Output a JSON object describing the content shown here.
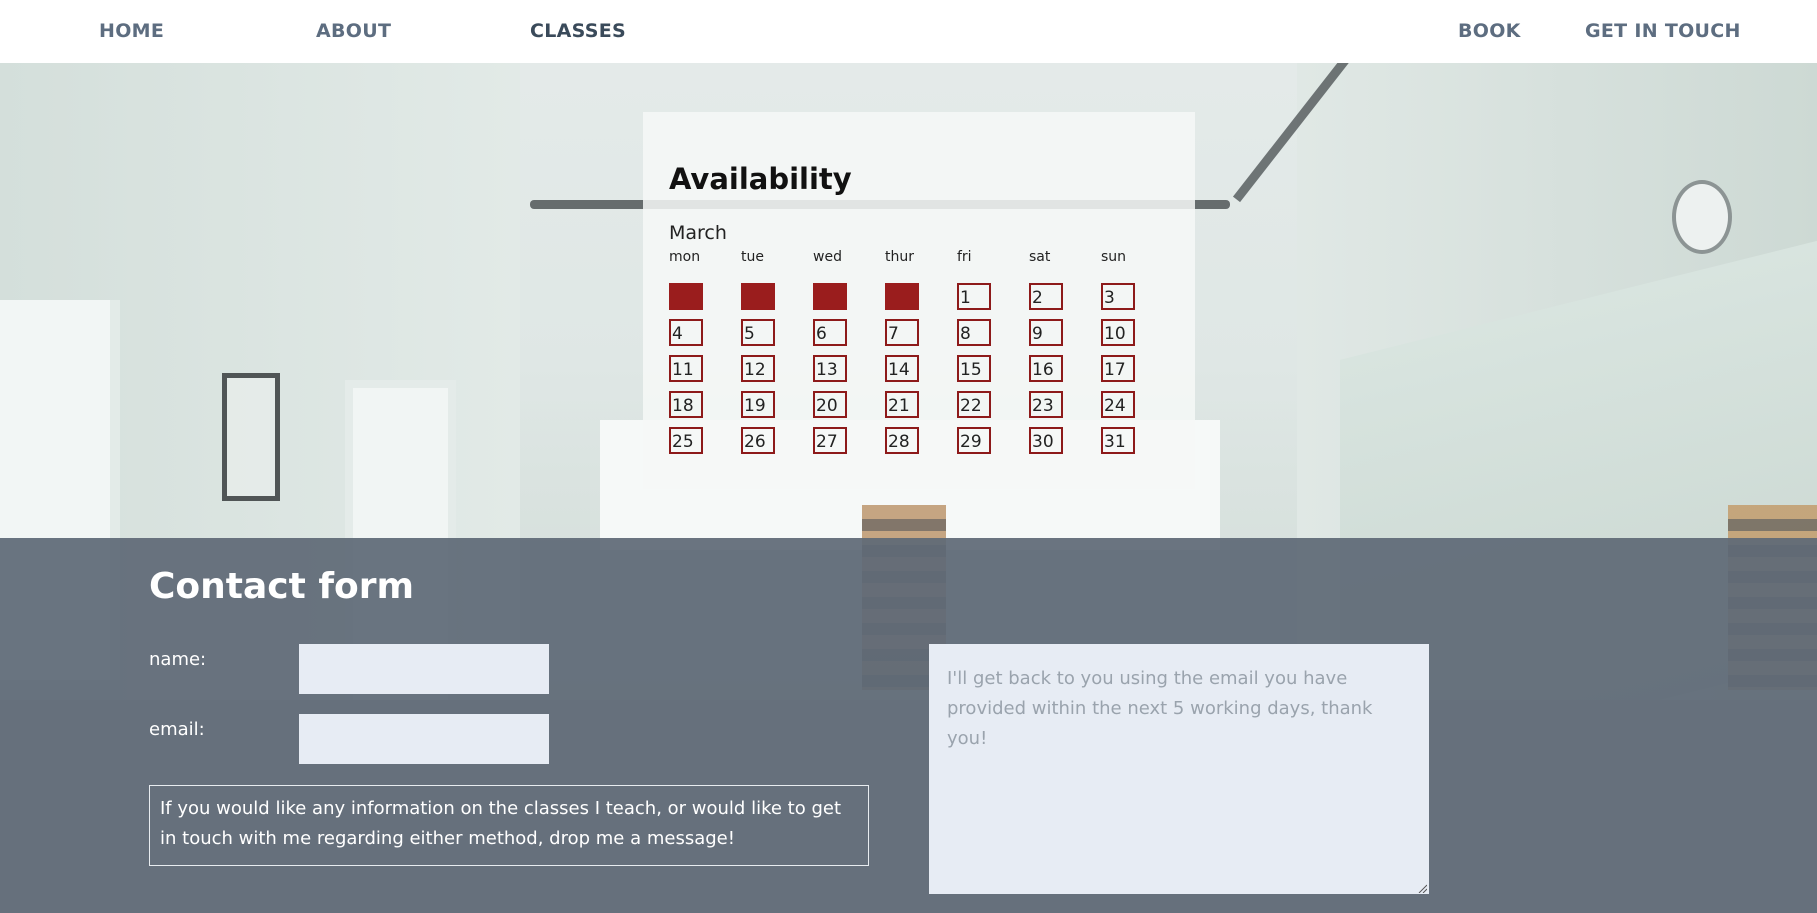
{
  "nav": {
    "home": "HOME",
    "about": "ABOUT",
    "classes": "CLASSES",
    "book": "BOOK",
    "contact": "GET IN TOUCH"
  },
  "availability": {
    "title": "Availability",
    "month": "March",
    "weekdays": [
      "mon",
      "tue",
      "wed",
      "thur",
      "fri",
      "sat",
      "sun"
    ],
    "leading_blank_days": 4,
    "days": [
      "1",
      "2",
      "3",
      "4",
      "5",
      "6",
      "7",
      "8",
      "9",
      "10",
      "11",
      "12",
      "13",
      "14",
      "15",
      "16",
      "17",
      "18",
      "19",
      "20",
      "21",
      "22",
      "23",
      "24",
      "25",
      "26",
      "27",
      "28",
      "29",
      "30",
      "31"
    ]
  },
  "contact": {
    "title": "Contact form",
    "name_label": "name:",
    "email_label": "email:",
    "info_text": "If you would like any information on the classes I teach, or would like to get in touch with me regarding either method, drop me a message!",
    "message_placeholder": "I'll get back to you using the email you have provided within the next 5 working days, thank you!"
  },
  "colors": {
    "nav_text": "#5d6d80",
    "accent_red": "#9a1d1d",
    "contact_bg": "#5f6976",
    "input_bg": "#e7ecf4"
  }
}
